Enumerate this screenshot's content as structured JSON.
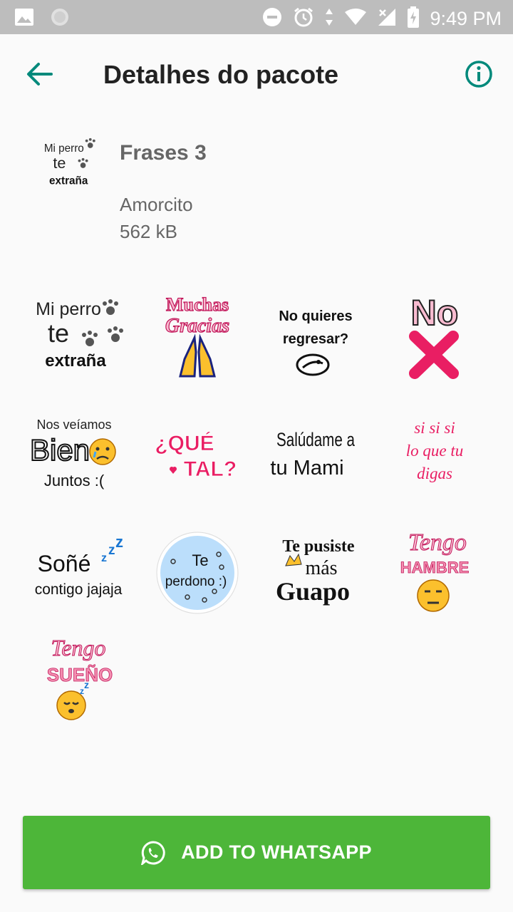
{
  "status_bar": {
    "time": "9:49 PM"
  },
  "app_bar": {
    "title": "Detalhes do pacote"
  },
  "pack": {
    "name": "Frases 3",
    "author": "Amorcito",
    "size": "562 kB"
  },
  "stickers": [
    {
      "lines": [
        "Mi perro",
        "te",
        "extraña"
      ]
    },
    {
      "lines": [
        "Muchas",
        "Gracias"
      ]
    },
    {
      "lines": [
        "No quieres",
        "regresar?"
      ]
    },
    {
      "lines": [
        "No"
      ]
    },
    {
      "lines": [
        "Nos veíamos",
        "Bien",
        "Juntos :("
      ]
    },
    {
      "lines": [
        "¿QUÉ",
        "TAL?"
      ]
    },
    {
      "lines": [
        "Salúdame a",
        "tu Mami"
      ]
    },
    {
      "lines": [
        "si si si",
        "lo que tu",
        "digas"
      ]
    },
    {
      "lines": [
        "Soñé",
        "contigo jajaja"
      ]
    },
    {
      "lines": [
        "Te",
        "perdono :)"
      ]
    },
    {
      "lines": [
        "Te pusiste",
        "más",
        "Guapo"
      ]
    },
    {
      "lines": [
        "Tengo",
        "HAMBRE"
      ]
    },
    {
      "lines": [
        "Tengo",
        "SUEÑO"
      ]
    }
  ],
  "actions": {
    "add_label": "ADD TO WHATSAPP"
  },
  "colors": {
    "accent": "#00897b",
    "button": "#4db639",
    "status_bar": "#bdbdbd",
    "sticker_pink": "#e91e63"
  }
}
